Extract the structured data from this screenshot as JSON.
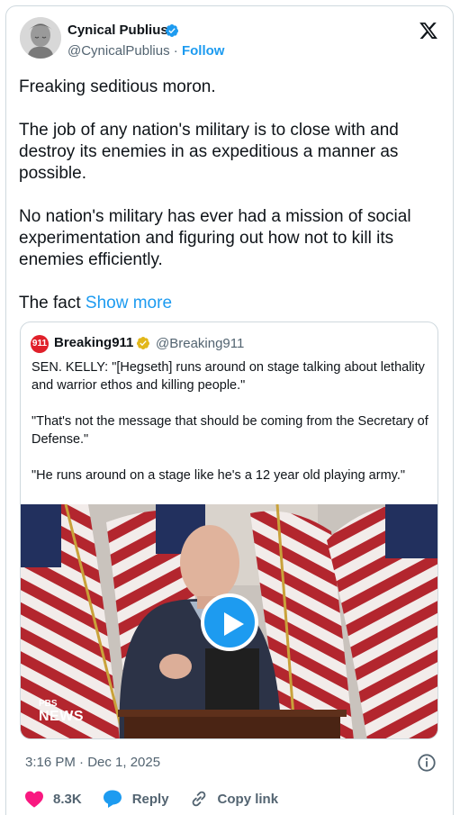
{
  "author": {
    "name": "Cynical Publius",
    "handle": "@CynicalPublius",
    "separator": " · ",
    "follow_label": "Follow"
  },
  "tweet": {
    "paragraphs": [
      "Freaking seditious moron.",
      "The job of any nation's military is to close with and destroy its enemies in as expeditious a manner as possible.",
      "No nation's military has ever had a mission of social experimentation and figuring out how not to kill its enemies efficiently."
    ],
    "truncated_text": "The fact ",
    "show_more_label": "Show more"
  },
  "quote": {
    "avatar_text": "911",
    "name": "Breaking911",
    "handle": "@Breaking911",
    "paragraphs": [
      "SEN. KELLY: \"[Hegseth] runs around on stage talking about lethality and warrior ethos and killing people.\"",
      "\"That's not the message that should be coming from the Secretary of Defense.\"",
      "\"He runs around on a stage like he's a 12 year old playing army.\""
    ],
    "video": {
      "watermark_top": "PBS",
      "watermark_bottom": "NEWS"
    }
  },
  "meta": {
    "timestamp": "3:16 PM · Dec 1, 2025"
  },
  "actions": {
    "likes": "8.3K",
    "reply_label": "Reply",
    "copy_link_label": "Copy link"
  },
  "colors": {
    "accent": "#1d9bf0",
    "like": "#f91880",
    "muted": "#536471",
    "verified_gold": "#e2b719"
  }
}
